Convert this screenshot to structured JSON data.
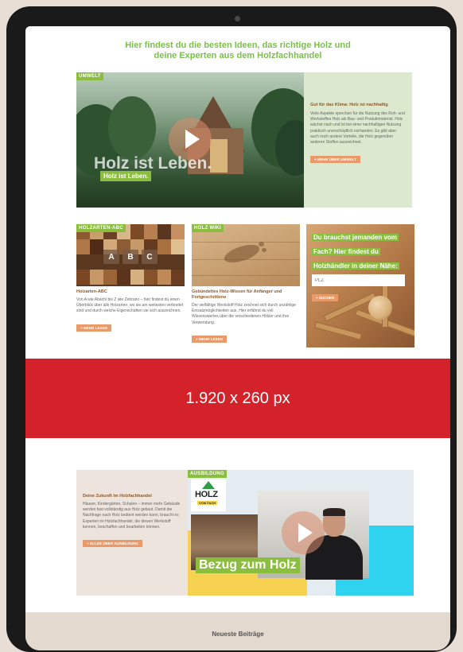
{
  "headline": {
    "line1": "Hier findest du die besten Ideen, das richtige Holz und",
    "line2": "deine Experten aus dem Holzfachhandel"
  },
  "hero": {
    "badge": "UMWELT",
    "overlay_big": "Holz ist Leben.",
    "overlay_small": "Holz ist Leben.",
    "title": "Gut für das Klima: Holz ist nachhaltig",
    "body": "Viele Aspekte sprechen für die Nutzung des Roh- und Werkstoffes Holz als Bau- und Produktmaterial. Holz wächst nach und ist bei einer nachhaltigen Nutzung praktisch unerschöpflich vorhanden. Es gibt aber auch noch andere Vorteile, die Holz gegenüber anderen Stoffen auszeichnet.",
    "button": "+ MEHR ÜBER UMWELT"
  },
  "cards": {
    "abc": {
      "badge": "HOLZARTEN-ABC",
      "letters": [
        "A",
        "B",
        "C"
      ],
      "title": "Holzarten-ABC",
      "body": "Von A wie Abachi bis Z wie Zebrano – hier findest du einen Überblick über alle Holzarten, wo sie am weitesten verbreitet sind und durch welche Eigenschaften sie sich auszeichnen.",
      "button": "+ MEHR LESEN"
    },
    "wiki": {
      "badge": "HOLZ WIKI",
      "title": "Gebündeltes Holz-Wissen für Anfänger und Fortgeschrittene",
      "body": "Der vielfältige Werkstoff Holz zeichnet sich durch unzählige Einsatzmöglichkeiten aus. Hier erfährst du viel Wissenswertes über die verschiedenen Hölzer und ihre Verwendung.",
      "button": "+ MEHR LESEN"
    },
    "search": {
      "question": "Du brauchst jemanden vom Fach? Hier findest du Holzhändler in deiner Nähe:",
      "placeholder": "PLZ",
      "button": "+ SUCHEN"
    }
  },
  "banner": {
    "text": "1.920 x 260 px"
  },
  "training": {
    "badge": "AUSBILDUNG",
    "title": "Deine Zukunft im Holzfachhandel",
    "body": "Häuser, Kindergärten, Schulen – immer mehr Gebäude werden fast vollständig aus Holz gebaut. Damit die Nachfrage nach Holz bedient werden kann, braucht es Experten im Holzfachhandel, die diesen Werkstoff kennen, beschaffen und bearbeiten können.",
    "button": "+ ALLES ÜBER AUSBILDUNG",
    "logo_word": "HOLZ",
    "logo_sub": "VOM FACH",
    "video_caption": "Bezug zum Holz"
  },
  "footer": {
    "title": "Neueste Beiträge"
  },
  "colors": {
    "accent_green": "#8bbd3f",
    "headline_green": "#7bbf4b",
    "button_orange": "#e89a6a",
    "banner_red": "#d3222a",
    "title_brown": "#8a5a2b"
  }
}
